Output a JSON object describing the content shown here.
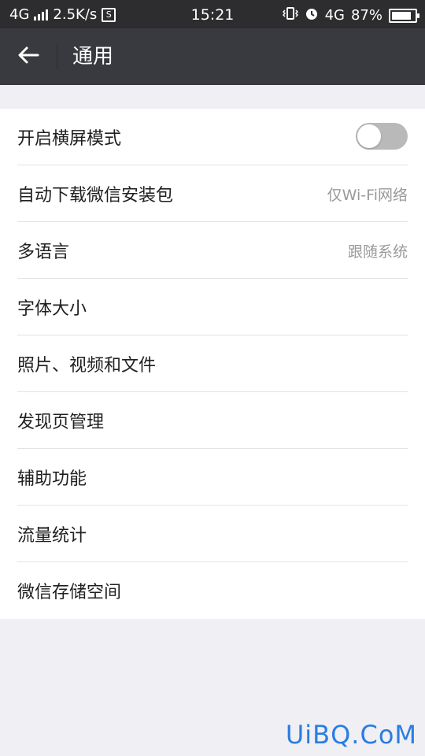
{
  "status_bar": {
    "network": "4G",
    "speed": "2.5K/s",
    "s_badge": "S",
    "time": "15:21",
    "network_right": "4G",
    "battery": "87%",
    "battery_level": 0.87
  },
  "header": {
    "title": "通用",
    "back_icon": "arrow-left-icon"
  },
  "settings": {
    "items": [
      {
        "label": "开启横屏模式",
        "value": "",
        "toggle": false
      },
      {
        "label": "自动下载微信安装包",
        "value": "仅Wi-Fi网络"
      },
      {
        "label": "多语言",
        "value": "跟随系统"
      },
      {
        "label": "字体大小",
        "value": ""
      },
      {
        "label": "照片、视频和文件",
        "value": ""
      },
      {
        "label": "发现页管理",
        "value": ""
      },
      {
        "label": "辅助功能",
        "value": ""
      },
      {
        "label": "流量统计",
        "value": ""
      },
      {
        "label": "微信存储空间",
        "value": ""
      }
    ]
  },
  "watermark": "UiBQ.CoM",
  "colors": {
    "status_bg": "#2d2d2f",
    "header_bg": "#393a3f",
    "page_bg": "#efeff4",
    "watermark": "#2a7de1",
    "toggle_off": "#b9b9b9"
  }
}
